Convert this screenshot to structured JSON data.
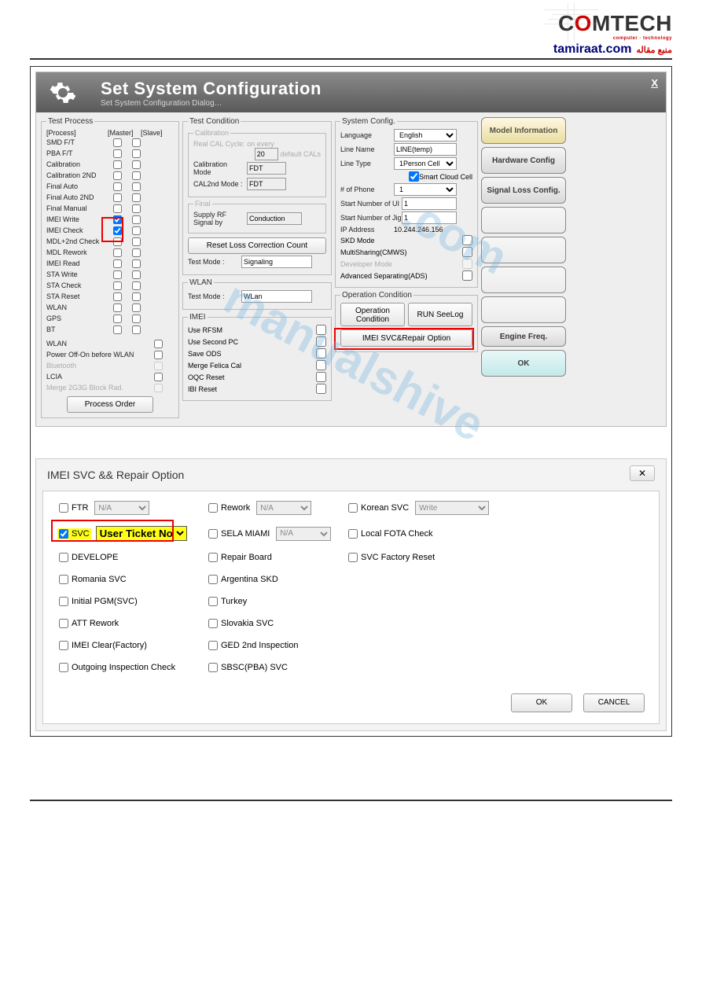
{
  "header": {
    "logo_main": "COMTECH",
    "logo_tag": "computer · technology",
    "site": "tamiraat.com",
    "site_label": "منبع مقاله"
  },
  "app": {
    "title": "Set System Configuration",
    "subtitle": "Set System Configuration Dialog…",
    "close": "X"
  },
  "test_process": {
    "legend": "Test Process",
    "head_process": "[Process]",
    "head_master": "[Master]",
    "head_slave": "[Slave]",
    "rows": [
      {
        "label": "SMD F/T",
        "m": false,
        "s": false
      },
      {
        "label": "PBA F/T",
        "m": false,
        "s": false
      },
      {
        "label": "Calibration",
        "m": false,
        "s": false
      },
      {
        "label": "Calibration 2ND",
        "m": false,
        "s": false
      },
      {
        "label": "Final Auto",
        "m": false,
        "s": false
      },
      {
        "label": "Final Auto 2ND",
        "m": false,
        "s": false
      },
      {
        "label": "Final Manual",
        "m": false,
        "s": false
      },
      {
        "label": "IMEI Write",
        "m": true,
        "s": false,
        "hl": true
      },
      {
        "label": "IMEI Check",
        "m": true,
        "s": false,
        "hl": true
      },
      {
        "label": "MDL+2nd Check",
        "m": false,
        "s": false
      },
      {
        "label": "MDL Rework",
        "m": false,
        "s": false
      },
      {
        "label": "IMEI Read",
        "m": false,
        "s": false
      },
      {
        "label": "STA Write",
        "m": false,
        "s": false
      },
      {
        "label": "STA Check",
        "m": false,
        "s": false
      },
      {
        "label": "STA Reset",
        "m": false,
        "s": false
      },
      {
        "label": "WLAN",
        "m": false,
        "s": false
      },
      {
        "label": "GPS",
        "m": false,
        "s": false
      },
      {
        "label": "BT",
        "m": false,
        "s": false
      }
    ],
    "extra": [
      {
        "label": "WLAN",
        "chk": false
      },
      {
        "label": "Power Off-On before WLAN",
        "chk": false
      },
      {
        "label": "Bluetooth",
        "chk": false,
        "disabled": true
      },
      {
        "label": "LCIA",
        "chk": false
      },
      {
        "label": "Merge 2G3G Block Rad.",
        "chk": false,
        "disabled": true
      }
    ],
    "process_order_btn": "Process Order"
  },
  "test_condition": {
    "legend": "Test Condition",
    "calibration_legend": "Calibration",
    "real_cal": "Real CAL Cycle: on every",
    "real_cal_val": "20",
    "real_cal_suffix": "default CALs",
    "cal_mode_lbl": "Calibration Mode",
    "cal_mode_val": "FDT",
    "cal2_lbl": "CAL2nd Mode :",
    "cal2_val": "FDT",
    "final_legend": "Final",
    "supply_lbl": "Supply RF Signal by",
    "supply_val": "Conduction",
    "reset_btn": "Reset Loss Correction Count",
    "tm_lbl": "Test Mode :",
    "tm_val": "Signaling",
    "wlan_legend": "WLAN",
    "wlan_tm_lbl": "Test Mode :",
    "wlan_tm_val": "WLan",
    "imei_legend": "IMEI",
    "imei_opts": [
      {
        "label": "Use RFSM",
        "chk": false
      },
      {
        "label": "Use Second PC",
        "chk": false
      },
      {
        "label": "Save ODS",
        "chk": false
      },
      {
        "label": "Merge Felica Cal",
        "chk": false
      },
      {
        "label": "OQC Reset",
        "chk": false
      },
      {
        "label": "IBI Reset",
        "chk": false
      }
    ]
  },
  "system_config": {
    "legend": "System Config.",
    "lang_lbl": "Language",
    "lang_val": "English",
    "linename_lbl": "Line Name",
    "linename_val": "LINE(temp)",
    "linetype_lbl": "Line Type",
    "linetype_val": "1Person Cell",
    "scc_lbl": "Smart Cloud Cell",
    "scc_chk": true,
    "numphone_lbl": "# of Phone",
    "numphone_val": "1",
    "startui_lbl": "Start Number of UI",
    "startui_val": "1",
    "startjig_lbl": "Start Number of Jig",
    "startjig_val": "1",
    "ip_lbl": "IP Address",
    "ip_val": "10.244.246.156",
    "skd_lbl": "SKD Mode",
    "ms_lbl": "MultiSharing(CMWS)",
    "dev_lbl": "Developer Mode",
    "ads_lbl": "Advanced Separating(ADS)",
    "op_legend": "Operation Condition",
    "op_btn": "Operation Condition",
    "run_btn": "RUN SeeLog",
    "repair_btn": "IMEI SVC&Repair Option"
  },
  "side_buttons": {
    "model_info": "Model Information",
    "hw_config": "Hardware Config",
    "sig_loss": "Signal Loss Config.",
    "faded1": "",
    "faded2": "",
    "faded3": "",
    "faded4": "",
    "engine": "Engine Freq.",
    "ok": "OK"
  },
  "dialog2": {
    "title": "IMEI SVC && Repair Option",
    "close": "✕",
    "colA": [
      {
        "label": "FTR",
        "sel": "N/A"
      },
      {
        "label": "SVC",
        "sel": "User Ticket No",
        "hl": true,
        "chk": true
      },
      {
        "label": "DEVELOPE"
      },
      {
        "label": "Romania SVC"
      },
      {
        "label": "Initial PGM(SVC)"
      },
      {
        "label": "ATT Rework"
      },
      {
        "label": "IMEI Clear(Factory)"
      },
      {
        "label": "Outgoing Inspection Check"
      }
    ],
    "colB": [
      {
        "label": "Rework",
        "sel": "N/A"
      },
      {
        "label": "SELA MIAMI",
        "sel": "N/A"
      },
      {
        "label": "Repair Board"
      },
      {
        "label": "Argentina SKD"
      },
      {
        "label": "Turkey"
      },
      {
        "label": "Slovakia SVC"
      },
      {
        "label": "GED 2nd Inspection"
      },
      {
        "label": "SBSC(PBA) SVC"
      }
    ],
    "colC": [
      {
        "label": "Korean SVC",
        "sel": "Write",
        "wide": true
      },
      {
        "label": "Local FOTA Check"
      },
      {
        "label": "SVC Factory Reset"
      }
    ],
    "ok": "OK",
    "cancel": "CANCEL"
  }
}
